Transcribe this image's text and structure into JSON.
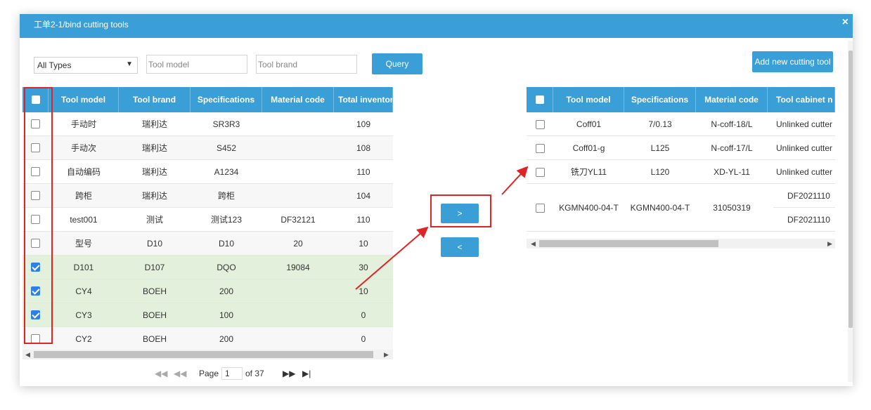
{
  "dialog": {
    "title": "工单2-1/bind cutting tools",
    "close_icon": "×"
  },
  "toolbar": {
    "type_select": "All Types",
    "tool_model_placeholder": "Tool model",
    "tool_brand_placeholder": "Tool brand",
    "query_label": "Query",
    "add_new_label": "Add new cutting tool"
  },
  "left_table": {
    "columns": [
      "Tool model",
      "Tool brand",
      "Specifications",
      "Material code",
      "Total inventory"
    ],
    "rows": [
      {
        "checked": false,
        "model": "手动时",
        "brand": "瑞利达",
        "spec": "SR3R3",
        "material": "",
        "total": "109"
      },
      {
        "checked": false,
        "model": "手动次",
        "brand": "瑞利达",
        "spec": "S452",
        "material": "",
        "total": "108"
      },
      {
        "checked": false,
        "model": "自动编码",
        "brand": "瑞利达",
        "spec": "A1234",
        "material": "",
        "total": "110"
      },
      {
        "checked": false,
        "model": "跨柜",
        "brand": "瑞利达",
        "spec": "跨柜",
        "material": "",
        "total": "104"
      },
      {
        "checked": false,
        "model": "test001",
        "brand": "测试",
        "spec": "测试123",
        "material": "DF32121",
        "total": "110"
      },
      {
        "checked": false,
        "model": "型号",
        "brand": "D10",
        "spec": "D10",
        "material": "20",
        "total": "10"
      },
      {
        "checked": true,
        "model": "D101",
        "brand": "D107",
        "spec": "DQO",
        "material": "19084",
        "total": "30"
      },
      {
        "checked": true,
        "model": "CY4",
        "brand": "BOEH",
        "spec": "200",
        "material": "",
        "total": "10"
      },
      {
        "checked": true,
        "model": "CY3",
        "brand": "BOEH",
        "spec": "100",
        "material": "",
        "total": "0"
      },
      {
        "checked": false,
        "model": "CY2",
        "brand": "BOEH",
        "spec": "200",
        "material": "",
        "total": "0"
      }
    ],
    "pager": {
      "page_label": "Page",
      "page_value": "1",
      "of_label": "of 37"
    }
  },
  "transfer": {
    "add_label": ">",
    "remove_label": "<"
  },
  "right_table": {
    "columns": [
      "Tool model",
      "Specifications",
      "Material code",
      "Tool cabinet n"
    ],
    "rows": [
      {
        "model": "Coff01",
        "spec": "7/0.13",
        "material": "N-coff-18/L",
        "cabinet": "Unlinked cutter"
      },
      {
        "model": "Coff01-g",
        "spec": "L125",
        "material": "N-coff-17/L",
        "cabinet": "Unlinked cutter"
      },
      {
        "model": "铣刀YL11",
        "spec": "L120",
        "material": "XD-YL-11",
        "cabinet": "Unlinked cutter"
      },
      {
        "model": "KGMN400-04-T",
        "spec": "KGMN400-04-T",
        "material": "31050319",
        "cabinet_a": "DF2021110",
        "cabinet_b": "DF2021110"
      }
    ]
  },
  "colors": {
    "accent": "#3a9fd6",
    "selected_row": "#e3f1dc",
    "highlight": "#e02424",
    "checkbox": "#2f7fe8"
  }
}
